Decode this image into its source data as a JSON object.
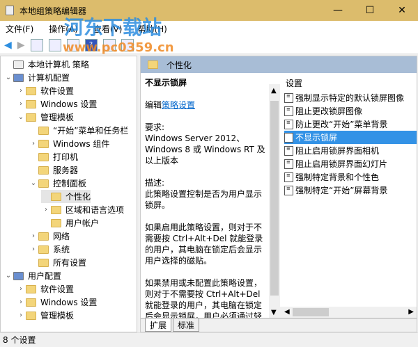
{
  "window": {
    "title": "本地组策略编辑器",
    "minimize": "—",
    "maximize": "☐",
    "close": "✕"
  },
  "watermark": {
    "line1": "河东下载站",
    "line2": "www.pc0359.cn"
  },
  "menu": [
    "文件(F)",
    "操作(A)",
    "查看(V)",
    "帮助(H)"
  ],
  "tree": [
    {
      "label": "本地计算机 策略",
      "level": 0,
      "chev": ""
    },
    {
      "label": "计算机配置",
      "level": 0,
      "chev": "⌄"
    },
    {
      "label": "软件设置",
      "level": 1,
      "chev": "›"
    },
    {
      "label": "Windows 设置",
      "level": 1,
      "chev": "›"
    },
    {
      "label": "管理模板",
      "level": 1,
      "chev": "⌄"
    },
    {
      "label": "“开始”菜单和任务栏",
      "level": 2,
      "chev": ""
    },
    {
      "label": "Windows 组件",
      "level": 2,
      "chev": "›"
    },
    {
      "label": "打印机",
      "level": 2,
      "chev": ""
    },
    {
      "label": "服务器",
      "level": 2,
      "chev": ""
    },
    {
      "label": "控制面板",
      "level": 2,
      "chev": "⌄"
    },
    {
      "label": "个性化",
      "level": 3,
      "chev": "",
      "selected": true
    },
    {
      "label": "区域和语言选项",
      "level": 3,
      "chev": "›"
    },
    {
      "label": "用户帐户",
      "level": 3,
      "chev": ""
    },
    {
      "label": "网络",
      "level": 2,
      "chev": "›"
    },
    {
      "label": "系统",
      "level": 2,
      "chev": "›"
    },
    {
      "label": "所有设置",
      "level": 2,
      "chev": ""
    },
    {
      "label": "用户配置",
      "level": 0,
      "chev": "⌄"
    },
    {
      "label": "软件设置",
      "level": 1,
      "chev": "›"
    },
    {
      "label": "Windows 设置",
      "level": 1,
      "chev": "›"
    },
    {
      "label": "管理模板",
      "level": 1,
      "chev": "›"
    }
  ],
  "header": {
    "title": "个性化"
  },
  "description": {
    "title": "不显示锁屏",
    "edit_prefix": "编辑",
    "edit_link": "策略设置",
    "req_label": "要求:",
    "req_text": "Windows Server 2012、Windows 8 或 Windows RT 及以上版本",
    "desc_label": "描述:",
    "desc_text": "此策略设置控制是否为用户显示锁屏。",
    "para1": "如果启用此策略设置，则对于不需要按 Ctrl+Alt+Del 就能登录的用户，其电脑在锁定后会显示用户选择的磁贴。",
    "para2": "如果禁用或未配置此策略设置，则对于不需要按 Ctrl+Alt+Del 就能登录的用户，其电脑在锁定后会显示锁屏，用户必须通过轻扫、键盘"
  },
  "settings": {
    "header": "设置",
    "items": [
      {
        "label": "强制显示特定的默认锁屏图像"
      },
      {
        "label": "阻止更改锁屏图像"
      },
      {
        "label": "防止更改“开始”菜单背景"
      },
      {
        "label": "不显示锁屏",
        "selected": true
      },
      {
        "label": "阻止启用锁屏界面相机"
      },
      {
        "label": "阻止启用锁屏界面幻灯片"
      },
      {
        "label": "强制特定背景和个性色"
      },
      {
        "label": "强制特定“开始”屏幕背景"
      }
    ]
  },
  "tabs": [
    "扩展",
    "标准"
  ],
  "status": "8 个设置"
}
